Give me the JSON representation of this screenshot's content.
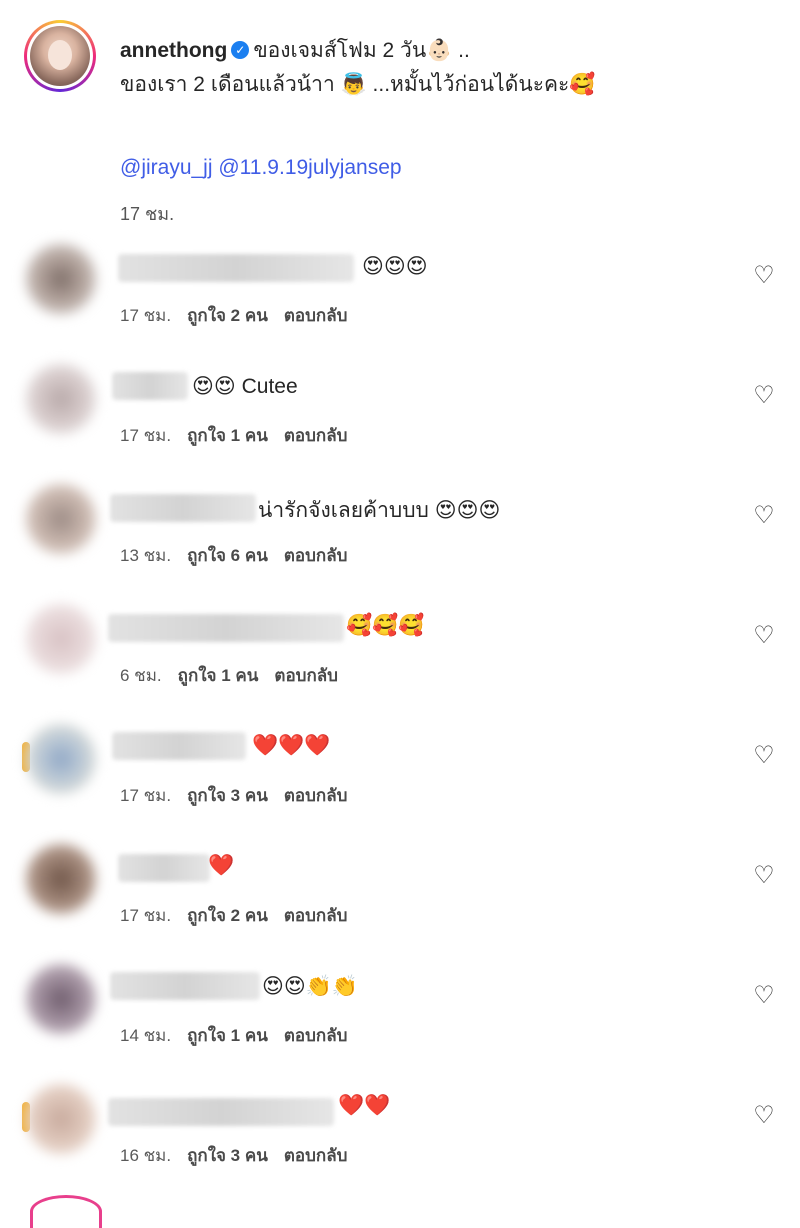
{
  "caption": {
    "username": "annethong",
    "line1": "ของเจมส์โฟม 2 วัน👶🏻 ..",
    "line2": "ของเรา 2 เดือนแล้วน้าา 👼 ...หมั้นไว้ก่อนได้นะคะ🥰",
    "mention1": "@jirayu_jj",
    "mention2": "@11.9.19julyjansep",
    "time": "17 ชม."
  },
  "reply_label": "ตอบกลับ",
  "comments": [
    {
      "text": "😍😍😍",
      "time": "17 ชม.",
      "likes": "ถูกใจ 2 คน"
    },
    {
      "text": "😍😍 Cutee",
      "time": "17 ชม.",
      "likes": "ถูกใจ 1 คน"
    },
    {
      "text": "น่ารักจังเลยค้าบบบ 😍😍😍",
      "time": "13 ชม.",
      "likes": "ถูกใจ 6 คน"
    },
    {
      "text": "🥰🥰🥰",
      "time": "6 ชม.",
      "likes": "ถูกใจ 1 คน"
    },
    {
      "text": "❤️❤️❤️",
      "time": "17 ชม.",
      "likes": "ถูกใจ 3 คน"
    },
    {
      "text": "❤️",
      "time": "17 ชม.",
      "likes": "ถูกใจ 2 คน"
    },
    {
      "text": "😍😍👏👏",
      "time": "14 ชม.",
      "likes": "ถูกใจ 1 คน"
    },
    {
      "text": "❤️❤️",
      "time": "16 ชม.",
      "likes": "ถูกใจ 3 คน"
    }
  ],
  "icons": {
    "like": "heart-outline-icon",
    "verified": "verified-badge-icon"
  }
}
